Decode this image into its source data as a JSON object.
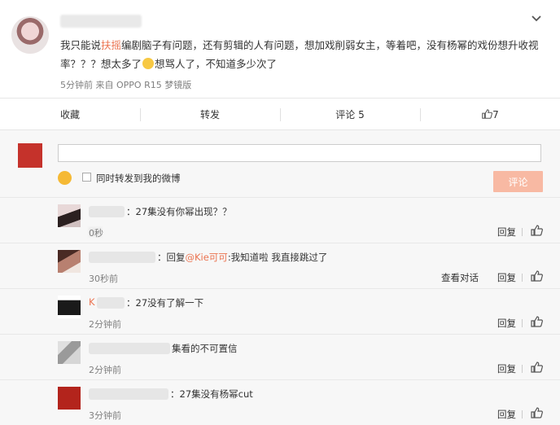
{
  "post": {
    "text_before_highlight": "我只能说",
    "highlight": "扶摇",
    "text_after_highlight": "编剧脑子有问题，还有剪辑的人有问题，想加戏削弱女主，等着吧，没有杨幂的戏份想升收视率？？？想太多了",
    "text_after_emoji": "想骂人了，不知道多少次了",
    "meta": "5分钟前 来自 OPPO R15 梦镜版"
  },
  "actions": {
    "favorite": "收藏",
    "repost": "转发",
    "comment": "评论 5",
    "like": "7"
  },
  "composer": {
    "input_value": "",
    "forward_label": "同时转发到我的微博",
    "submit_label": "评论"
  },
  "replies": [
    {
      "text": "：27集没有你幂出现？？",
      "time": "0秒",
      "reply": "回复"
    },
    {
      "prefix": "：回复",
      "mention": "@Kie可可",
      "suffix": ":我知道啦 我直接跳过了",
      "time": "30秒前",
      "view": "查看对话",
      "reply": "回复"
    },
    {
      "name_visible": "K",
      "text": "：27没有了解一下",
      "time": "2分钟前",
      "reply": "回复"
    },
    {
      "text": "集看的不可置信",
      "time": "2分钟前",
      "reply": "回复"
    },
    {
      "text": "：27集没有杨幂cut",
      "time": "3分钟前",
      "reply": "回复"
    }
  ],
  "colors": {
    "accent": "#eb7350",
    "submit_bg": "#f8b9a3",
    "comment_bg": "#f7f7f7"
  }
}
